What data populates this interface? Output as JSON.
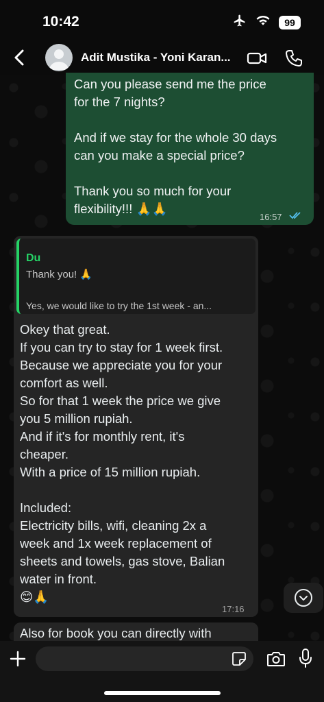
{
  "status_bar": {
    "time": "10:42",
    "battery": "99",
    "icons": [
      "airplane-icon",
      "wifi-icon",
      "battery-icon"
    ]
  },
  "header": {
    "contact_name": "Adit Mustika - Yoni Karan...",
    "icons": [
      "back-arrow-icon",
      "avatar",
      "video-call-icon",
      "phone-call-icon"
    ]
  },
  "messages": {
    "outgoing_1": {
      "text": "Can you please send me the price\nfor the 7 nights?\n\nAnd if we stay for the whole 30 days\ncan you make a special price?\n\nThank you so much for your\nflexibility!!! 🙏🙏",
      "time": "16:57",
      "status": "read"
    },
    "incoming_1": {
      "quote": {
        "author": "Du",
        "line1": "Thank you! 🙏",
        "line2": "Yes, we would like to try the 1st week - an..."
      },
      "text": "Okey that great.\nIf you can try to stay for 1 week first.\nBecause we appreciate you for your\ncomfort as well.\nSo for that 1 week the price we give\nyou 5 million rupiah.\nAnd if it's for monthly rent, it's\ncheaper.\nWith a price of 15 million rupiah.\n\nIncluded:\nElectricity bills, wifi, cleaning 2x a\nweek and 1x week replacement of\nsheets and towels, gas stove, Balian\nwater in front.\n😊🙏",
      "time": "17:16"
    },
    "incoming_2": {
      "text": "Also for book you can directly with"
    }
  },
  "composer": {
    "placeholder": "",
    "icons": [
      "plus-icon",
      "sticker-icon",
      "camera-icon",
      "microphone-icon"
    ]
  },
  "colors": {
    "outgoing_bubble": "#1d4e33",
    "incoming_bubble": "#252525",
    "quote_accent": "#25d366",
    "read_ticks": "#53bdeb"
  }
}
